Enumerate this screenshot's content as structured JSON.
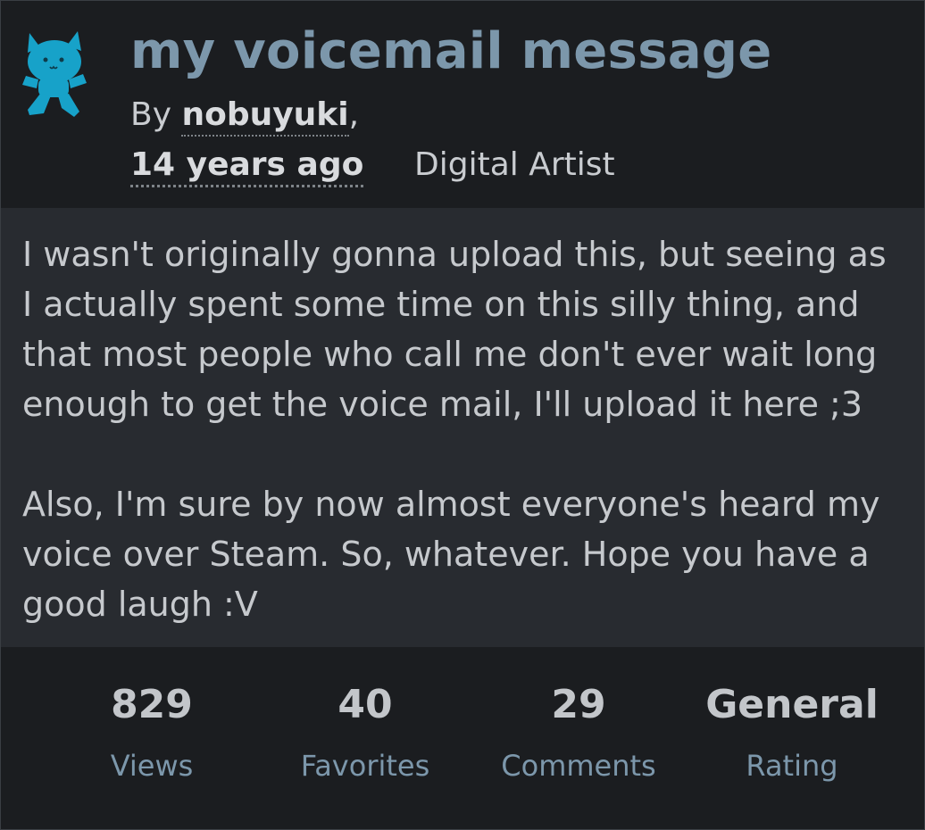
{
  "submission": {
    "title": "my voicemail message",
    "by_label": "By ",
    "author": "nobuyuki",
    "author_suffix": ",",
    "posted_ago": "14 years ago",
    "role": "Digital Artist",
    "avatar_icon": "blue-cat-avatar-icon",
    "accent_color": "#7c97ab",
    "avatar_color": "#17a2c9"
  },
  "description": {
    "paragraph_1": "I wasn't originally gonna upload this, but seeing as I actually spent some time on this silly thing, and that most people who call me don't ever wait long enough to get the voice mail, I'll upload it here ;3",
    "paragraph_2": "Also, I'm sure by now almost everyone's heard my voice over Steam. So, whatever. Hope you have a good laugh :V"
  },
  "stats": [
    {
      "value": "829",
      "label": "Views"
    },
    {
      "value": "40",
      "label": "Favorites"
    },
    {
      "value": "29",
      "label": "Comments"
    },
    {
      "value": "General",
      "label": "Rating"
    }
  ]
}
